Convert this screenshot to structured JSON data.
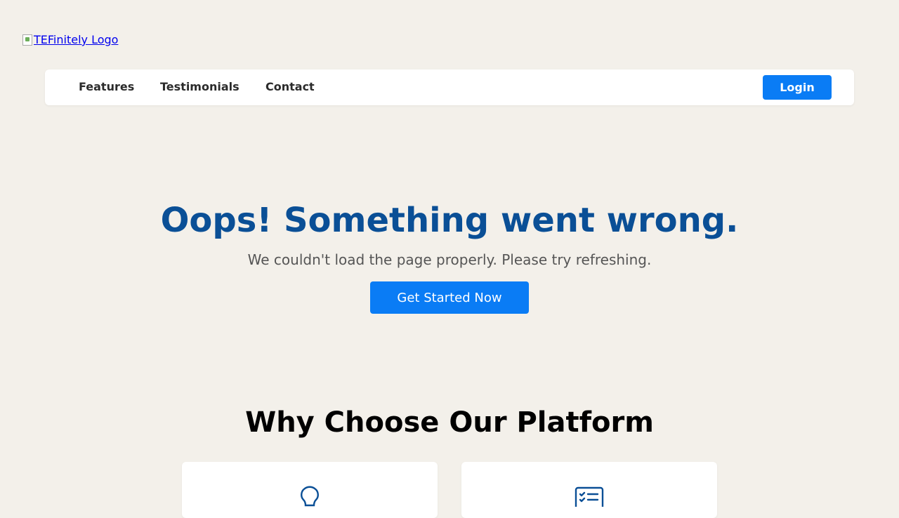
{
  "logo": {
    "alt_text": "TEFinitely Logo"
  },
  "nav": {
    "links": [
      "Features",
      "Testimonials",
      "Contact"
    ],
    "login_label": "Login"
  },
  "hero": {
    "title": "Oops! Something went wrong.",
    "subtitle": "We couldn't load the page properly. Please try refreshing.",
    "cta_label": "Get Started Now"
  },
  "features": {
    "title": "Why Choose Our Platform",
    "cards": [
      {
        "icon": "lightbulb-icon"
      },
      {
        "icon": "checklist-icon"
      }
    ]
  },
  "colors": {
    "background": "#f3f0ea",
    "primary": "#0a7cf5",
    "heading_blue": "#0a4f96",
    "icon_blue": "#0a4f96"
  }
}
